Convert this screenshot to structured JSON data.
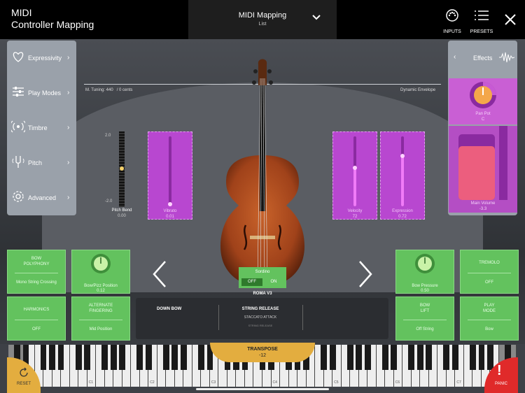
{
  "header": {
    "title_line1": "MIDI",
    "title_line2": "Controller Mapping",
    "mapping_title": "MIDI Mapping",
    "mapping_subtitle": "List",
    "inputs_label": "INPUTS",
    "presets_label": "PRESETS"
  },
  "sidebar": {
    "items": [
      {
        "label": "Expressivity",
        "icon": "heart-icon"
      },
      {
        "label": "Play Modes",
        "icon": "sliders-icon"
      },
      {
        "label": "Timbre",
        "icon": "broadcast-icon"
      },
      {
        "label": "Pitch",
        "icon": "tuning-fork-icon"
      },
      {
        "label": "Advanced",
        "icon": "gear-icon"
      }
    ]
  },
  "effects": {
    "label": "Effects",
    "pan_pot_label": "Pan Pot",
    "pan_pot_value": "C",
    "main_volume_label": "Main Volume",
    "main_volume_value": "-3.3",
    "main_volume_level": 0.82
  },
  "stage": {
    "tuning": "M. Tuning: 440",
    "cents": "/ 0 cents",
    "dynamic_envelope": "Dynamic Envelope",
    "pitch_bend_label": "Pitch Bend",
    "pitch_bend_value": "0.00",
    "pitch_bend_top": "2.0",
    "pitch_bend_bottom": "-2.0",
    "sordino_label": "Sordino",
    "sordino_off": "OFF",
    "sordino_on": "ON",
    "preset_name": "ROMA V3"
  },
  "faders": [
    {
      "label": "Vibrato",
      "value": "0.01",
      "level": 0.03
    },
    {
      "label": "Velocity",
      "value": "72",
      "level": 0.55
    },
    {
      "label": "Expression",
      "value": "0.72",
      "level": 0.72
    }
  ],
  "left_buttons": [
    {
      "title": "BOW POLYPHONY",
      "value": "Mono String Crossing"
    },
    {
      "title": "Bow/Pizz Position",
      "value": "0.12"
    },
    {
      "title": "HARMONICS",
      "value": "OFF"
    },
    {
      "title": "ALTERNATE FINGERING",
      "value": "Mid Position"
    }
  ],
  "right_buttons": [
    {
      "title": "Bow Pressure",
      "value": "0.50"
    },
    {
      "title": "TREMOLO",
      "value": "OFF"
    },
    {
      "title": "BOW LIFT",
      "value": "Off String"
    },
    {
      "title": "PLAY MODE",
      "value": "Bow"
    }
  ],
  "articulation": {
    "down_bow": "DOWN BOW",
    "string_release": "STRING RELEASE",
    "staccato_attack": "STACCATO ATTACK",
    "string_release_small": "STRING RELEASE"
  },
  "keyboard": {
    "transpose_label": "TRANSPOSE",
    "transpose_value": "-12",
    "octaves": [
      "C0",
      "C1",
      "C2",
      "C3",
      "C4",
      "C5",
      "C6",
      "C7"
    ],
    "reset_label": "RESET",
    "panic_label": "PANIC"
  },
  "colors": {
    "purple": "#b847d0",
    "green": "#63c25e",
    "panic": "#e02a2a",
    "transpose": "#e3ad3f"
  }
}
